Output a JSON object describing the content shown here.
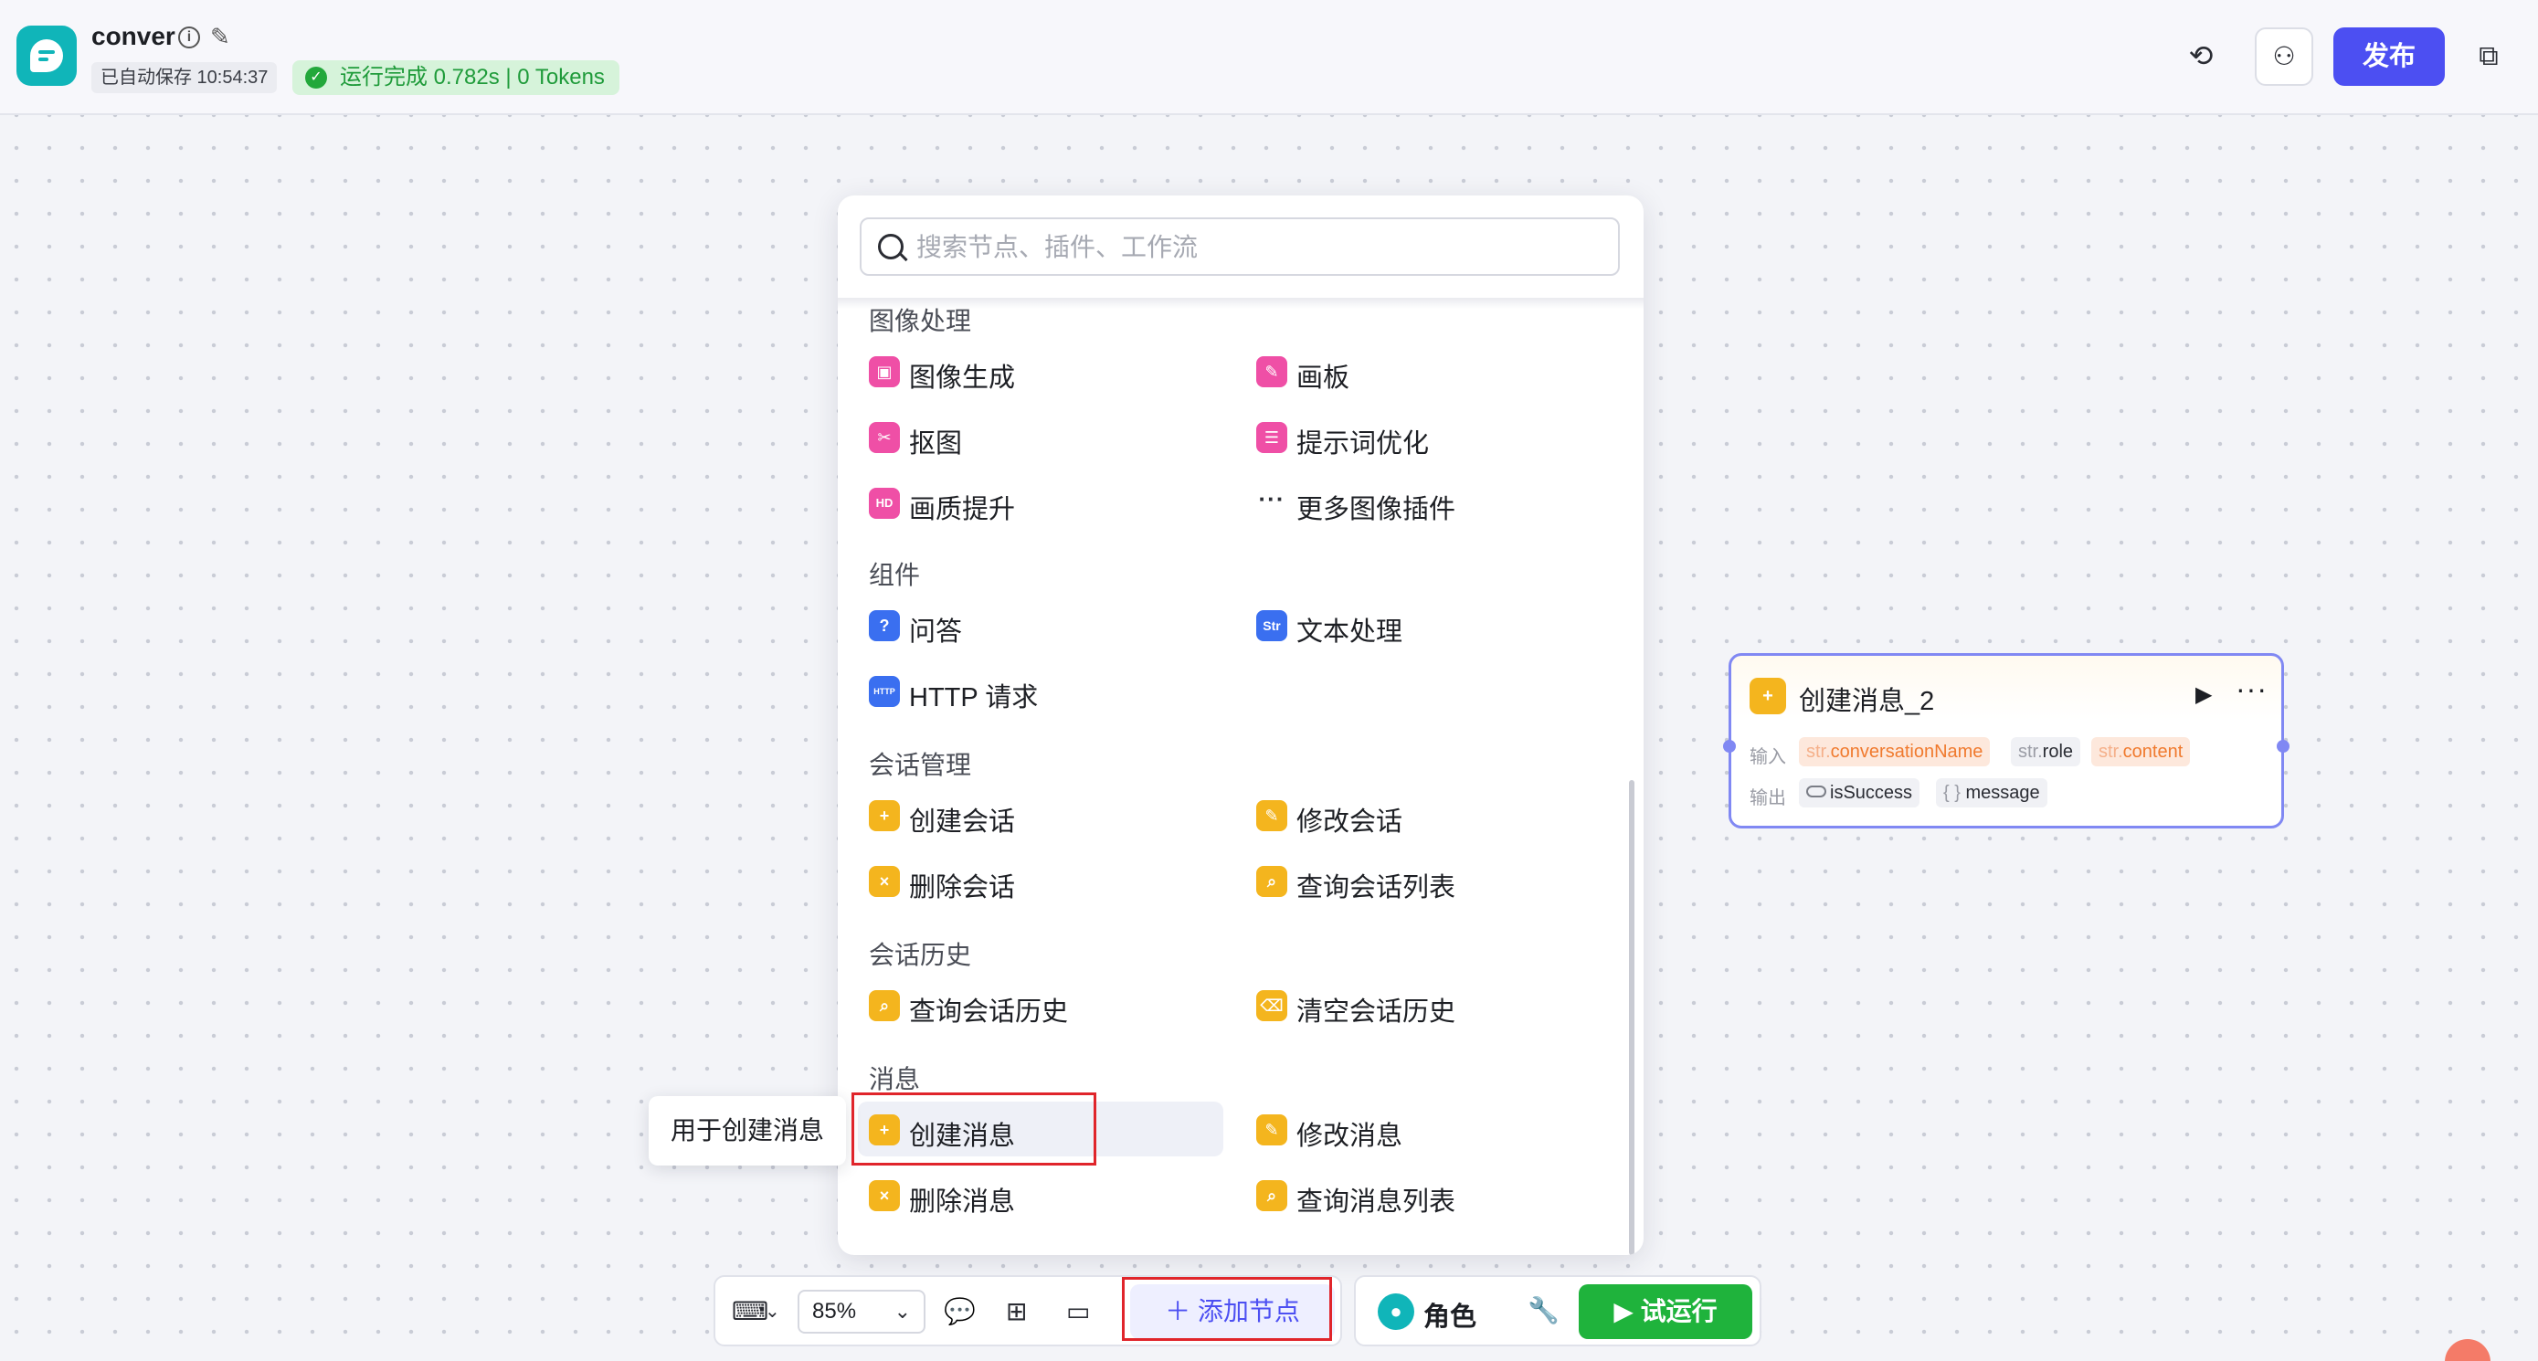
{
  "header": {
    "app_name": "conver",
    "autosave": "已自动保存 10:54:37",
    "run_status": "运行完成 0.782s | 0 Tokens",
    "publish_label": "发布"
  },
  "panel": {
    "search_placeholder": "搜索节点、插件、工作流",
    "sections": {
      "image": {
        "title": "图像处理",
        "items": [
          "图像生成",
          "画板",
          "抠图",
          "提示词优化",
          "画质提升",
          "更多图像插件"
        ]
      },
      "components": {
        "title": "组件",
        "items": [
          "问答",
          "文本处理",
          "HTTP 请求"
        ]
      },
      "conversation": {
        "title": "会话管理",
        "items": [
          "创建会话",
          "修改会话",
          "删除会话",
          "查询会话列表"
        ]
      },
      "history": {
        "title": "会话历史",
        "items": [
          "查询会话历史",
          "清空会话历史"
        ]
      },
      "message": {
        "title": "消息",
        "items": [
          "创建消息",
          "修改消息",
          "删除消息",
          "查询消息列表"
        ]
      }
    },
    "tooltip": "用于创建消息"
  },
  "canvas_node": {
    "title": "创建消息_2",
    "input_label": "输入",
    "output_label": "输出",
    "inputs": [
      {
        "type": "str.",
        "name": "conversationName"
      },
      {
        "type": "str.",
        "name": "role"
      },
      {
        "type": "str.",
        "name": "content"
      }
    ],
    "outputs": [
      {
        "name": "isSuccess"
      },
      {
        "type": "{ }",
        "name": "message"
      }
    ]
  },
  "toolbar": {
    "zoom": "85%",
    "add_node_label": "添加节点",
    "role_label": "角色",
    "run_label": "试运行"
  },
  "icons": {
    "app": "chat-bubble-icon",
    "history": "clock-history-icon",
    "collaborators": "users-icon",
    "layout": "layout-icon"
  },
  "colors": {
    "accent": "#4c4ff2",
    "success": "#1fb33c",
    "node_yellow": "#f4b51e",
    "node_pink": "#ef4fa6",
    "node_blue": "#3a6ff0",
    "highlight_red": "#e0252b"
  }
}
